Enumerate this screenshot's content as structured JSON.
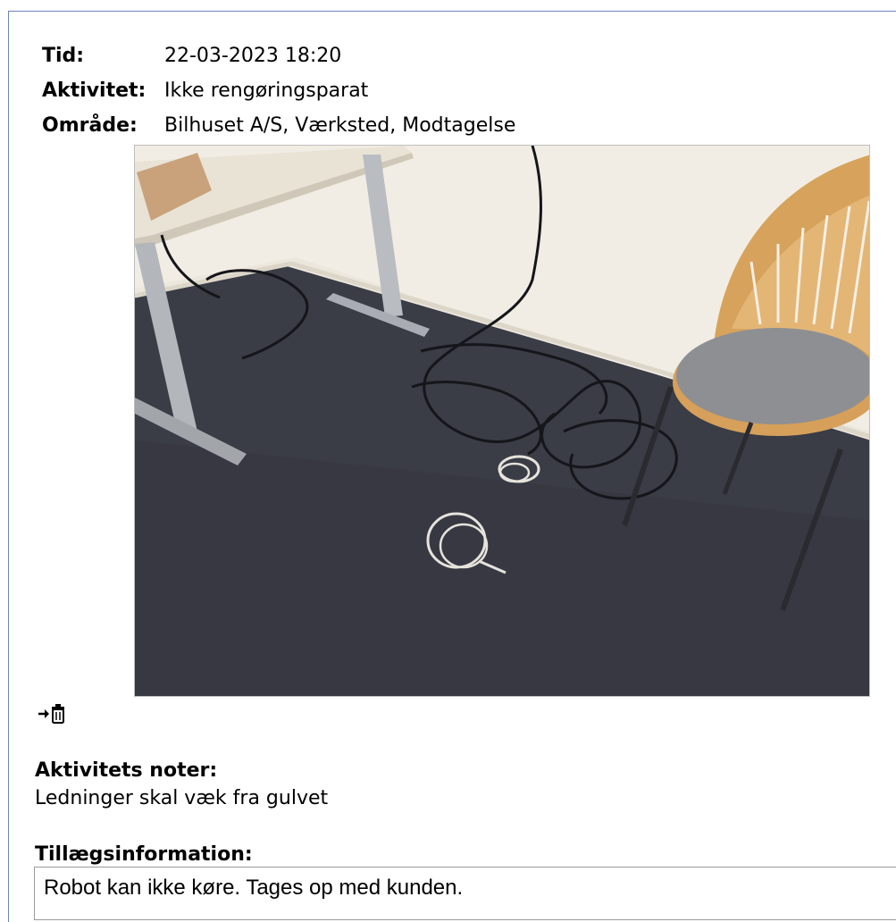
{
  "activity": {
    "tid_label": "Tid:",
    "tid_value": "22-03-2023 18:20",
    "aktivitet_label": "Aktivitet:",
    "aktivitet_value": "Ikke rengøringsparat",
    "omraade_label": "Område:",
    "omraade_value": "Bilhuset A/S, Værksted, Modtagelse"
  },
  "photo": {
    "icon": "activity-photo"
  },
  "attachment": {
    "icon": "arrow-trash-icon"
  },
  "notes": {
    "label": "Aktivitets noter:",
    "text": "Ledninger skal væk fra gulvet"
  },
  "additional": {
    "label": "Tillægsinformation:",
    "value": "Robot kan ikke køre. Tages op med kunden."
  }
}
